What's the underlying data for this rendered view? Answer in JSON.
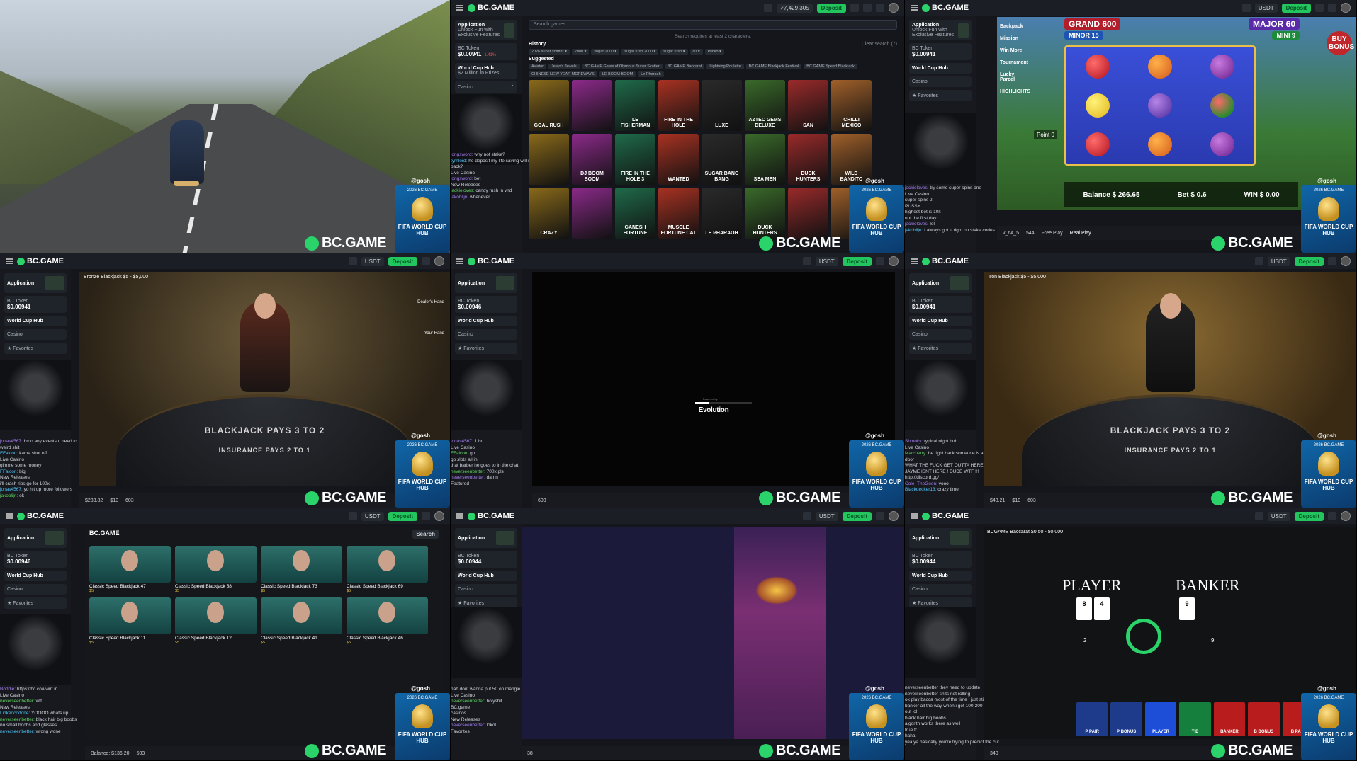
{
  "site": {
    "brand": "BC.GAME",
    "deposit": "Deposit",
    "currency": "USDT",
    "balance_top": "₮7,429,305"
  },
  "sidebar": {
    "app_title": "Application",
    "app_sub": "Unlock Fun with Exclusive Features",
    "token": "BC Token",
    "token_val1": "$0.00941",
    "token_val2": "$0.00946",
    "token_val3": "$0.00944",
    "token_chg": "-1.41%",
    "worldcup": "World Cup Hub",
    "worldcup_sub": "$2 Million in Prizes",
    "casino": "Casino",
    "favorites": "Favorites"
  },
  "streams": {
    "watermark": "BC.GAME",
    "gosh": "@gosh",
    "promo_title": "FIFA WORLD CUP HUB",
    "promo_sub": "2026 BC.GAME"
  },
  "panel2": {
    "search_placeholder": "Search games",
    "hint": "Search requires at least 2 characters.",
    "history": "History",
    "clear": "Clear search (7)",
    "history_tags": [
      "2026 super scatter ▾",
      "2000 ▾",
      "sugar 2000 ▾",
      "sugar rush 2000 ▾",
      "sugar rush ▾",
      "cu ▾",
      "Plinko ▾"
    ],
    "suggested": "Suggested",
    "suggested_tags": [
      "Aviator",
      "Jeteo's Jewels",
      "BC.GAME Gates of Olympus Super Scatter",
      "BC.GAME Baccarat",
      "Lightning Roulette",
      "BC.GAME Blackjack Festival",
      "BC.GAME Speed Blackjack",
      "CHINESE NEW YEAR MOREWAYS",
      "LE BOOM BOOM",
      "Le Pharaoh"
    ],
    "games": [
      "GOAL RUSH",
      "",
      "LE FISHERMAN",
      "FIRE IN THE HOLE",
      "LUXE",
      "AZTEC GEMS DELUXE",
      "SAN",
      "CHILLI MEXICO",
      "",
      "DJ BOOM BOOM",
      "FIRE IN THE HOLE 3",
      "WANTED",
      "SUGAR BANG BANG",
      "SEA MEN",
      "DUCK HUNTERS",
      "WILD BANDITO",
      "CRAZY",
      "",
      "GANESH FORTUNE",
      "MUSCLE FORTUNE CAT",
      "LE PHARAOH",
      "DUCK HUNTERS",
      "",
      ""
    ],
    "chat": [
      {
        "u": "longsword",
        "m": "why not stake?"
      },
      {
        "u": "tyrnlord",
        "m": "he deposit my life saving will i make it back?"
      },
      {
        "u": "",
        "m": "Live Casino"
      },
      {
        "u": "longsword",
        "m": "bet"
      },
      {
        "u": "",
        "m": "New Releases"
      },
      {
        "u": "jackieloves",
        "m": "candy rush in vnd"
      },
      {
        "u": "jakoblijn",
        "m": "whenever"
      }
    ]
  },
  "panel3": {
    "jackpots": [
      {
        "label": "GRAND",
        "val": "600"
      },
      {
        "label": "MAJOR",
        "val": "60"
      },
      {
        "label": "MINOR",
        "val": "15"
      },
      {
        "label": "MINI",
        "val": "9"
      }
    ],
    "side": [
      "Backpack",
      "Mission",
      "Win More",
      "Tournament",
      "Lucky Parcel",
      "HIGHLIGHTS"
    ],
    "point": "Point",
    "point_val": "0",
    "buy_bonus": "BUY BONUS",
    "balance_label": "Balance",
    "balance": "$ 266.65",
    "bet_label": "Bet",
    "bet": "$ 0.6",
    "win_label": "WIN",
    "win": "$ 0.00",
    "version": "v_64_5",
    "count": "544",
    "free_play": "Free Play",
    "real_play": "Real Play",
    "chat": [
      {
        "u": "jackieloves",
        "m": "try some super spins one"
      },
      {
        "u": "",
        "m": "Live Casino"
      },
      {
        "u": "",
        "m": "super spins 2"
      },
      {
        "u": "",
        "m": "PUSSY"
      },
      {
        "u": "",
        "m": "highest bet is 10k"
      },
      {
        "u": "",
        "m": "not the first day"
      },
      {
        "u": "jackieloves",
        "m": "lol"
      },
      {
        "u": "jakoblijn",
        "m": "I always got u right on stake codes"
      }
    ]
  },
  "panel4": {
    "title": "Bronze Blackjack $5 - $5,000",
    "felt": "BLACKJACK PAYS 3 TO 2",
    "felt2": "INSURANCE PAYS 2 TO 1",
    "dealers_hand": "Dealer's Hand",
    "your_hand": "Your Hand",
    "balance": "$233.82",
    "total_bet": "$10",
    "count": "603",
    "chat": [
      {
        "u": "jonas4567",
        "m": "broo any events u need to step up no weird shit"
      },
      {
        "u": "FFalcon",
        "m": "kama shut off"
      },
      {
        "u": "",
        "m": "Live Casino"
      },
      {
        "u": "",
        "m": "gimme some money"
      },
      {
        "u": "FFalcon",
        "m": "big"
      },
      {
        "u": "",
        "m": "New Releases"
      },
      {
        "u": "",
        "m": "i'll crash rips go for 100x"
      },
      {
        "u": "jonas4567",
        "m": "yo hit up more followers"
      },
      {
        "u": "jakoblijn",
        "m": "ok"
      }
    ]
  },
  "panel5": {
    "powered": "Powered by",
    "evolution": "Evolution",
    "count": "603",
    "chat": [
      {
        "u": "jonas4567",
        "m": "1 ho"
      },
      {
        "u": "",
        "m": "Live Casino"
      },
      {
        "u": "FFalcon",
        "m": "go"
      },
      {
        "u": "",
        "m": "go slots all in"
      },
      {
        "u": "",
        "m": "that barber he goes to in the chat"
      },
      {
        "u": "neverseenbetter",
        "m": "700x pls"
      },
      {
        "u": "neverseenbetter",
        "m": "damn"
      },
      {
        "u": "",
        "m": "Featured"
      }
    ]
  },
  "panel6": {
    "title": "Iron Blackjack $5 - $5,000",
    "felt": "BLACKJACK PAYS 3 TO 2",
    "felt2": "INSURANCE PAYS 2 TO 1",
    "balance": "$43.21",
    "total_bet": "$10",
    "count": "603",
    "chat": [
      {
        "u": "Shmoky",
        "m": "typical night huh"
      },
      {
        "u": "",
        "m": "Live Casino"
      },
      {
        "u": "Marcherry",
        "m": "he right back someone is at my back door"
      },
      {
        "u": "",
        "m": "WHAT THE FUCK GET OUTTA HERE"
      },
      {
        "u": "",
        "m": "JAYME ISNT HERE ! DUDE WTF !!!"
      },
      {
        "u": "",
        "m": "http://discord.gg/"
      },
      {
        "u": "Cole_TheGoon",
        "m": "yooo"
      },
      {
        "u": "Blackdecker13",
        "m": "crazy time"
      }
    ]
  },
  "panel7": {
    "search": "Search",
    "rows": [
      [
        "Classic Speed Blackjack 47",
        "Classic Speed Blackjack 58",
        "Classic Speed Blackjack 73",
        "Classic Speed Blackjack 69"
      ],
      [
        "Classic Speed Blackjack 11",
        "Classic Speed Blackjack 12",
        "Classic Speed Blackjack 41",
        "Classic Speed Blackjack 46"
      ]
    ],
    "price": "$5",
    "balance": "Balance: $136.20",
    "count": "603",
    "chat": [
      {
        "u": "Boddie",
        "m": "https://bc.co/i-wirt.in"
      },
      {
        "u": "",
        "m": "Live Casino"
      },
      {
        "u": "neverseenbetter",
        "m": "wtf"
      },
      {
        "u": "",
        "m": "New Releases"
      },
      {
        "u": "Linkedcodone",
        "m": "YOOOO whats up"
      },
      {
        "u": "neverseenbetter",
        "m": "black hair big boobs"
      },
      {
        "u": "",
        "m": "no small boobs and glasses"
      },
      {
        "u": "neverseenbetter",
        "m": "wrong wone"
      }
    ]
  },
  "panel8": {
    "count": "38",
    "chat": [
      {
        "u": "",
        "m": "nah dont wanna put 50 on mangle on bacca"
      },
      {
        "u": "",
        "m": "Live Casino"
      },
      {
        "u": "neverseenbetter",
        "m": "holyshit"
      },
      {
        "u": "",
        "m": "BC.game"
      },
      {
        "u": "",
        "m": "casinos"
      },
      {
        "u": "",
        "m": "New Releases"
      },
      {
        "u": "neverseenbetter",
        "m": "lokol"
      },
      {
        "u": "",
        "m": "Favorites"
      }
    ]
  },
  "panel9": {
    "title": "BCGAME Baccarat $0.50 - 50,000",
    "player": "PLAYER",
    "banker": "BANKER",
    "p_score": "2",
    "b_score": "9",
    "bets": [
      "P PAIR",
      "P BONUS",
      "PLAYER",
      "TIE",
      "BANKER",
      "B BONUS",
      "B PAIR"
    ],
    "count": "340",
    "chat": [
      {
        "u": "",
        "m": "neverseenbetter they need to update"
      },
      {
        "u": "",
        "m": "neverseenbetter shits not rolling"
      },
      {
        "u": "",
        "m": "ok play bacca most of the time i just stick with"
      },
      {
        "u": "",
        "m": "banker all the way when i get 100-200 profit i got out lol"
      },
      {
        "u": "",
        "m": "black hair big boobs"
      },
      {
        "u": "",
        "m": "algorith works there as well"
      },
      {
        "u": "",
        "m": "true fr"
      },
      {
        "u": "",
        "m": "haha"
      },
      {
        "u": "",
        "m": "yea ya basically you're trying to predict the cut"
      }
    ]
  },
  "colors": {
    "accent": "#22c55e",
    "bg": "#14161b",
    "sidebar": "#17191f"
  }
}
